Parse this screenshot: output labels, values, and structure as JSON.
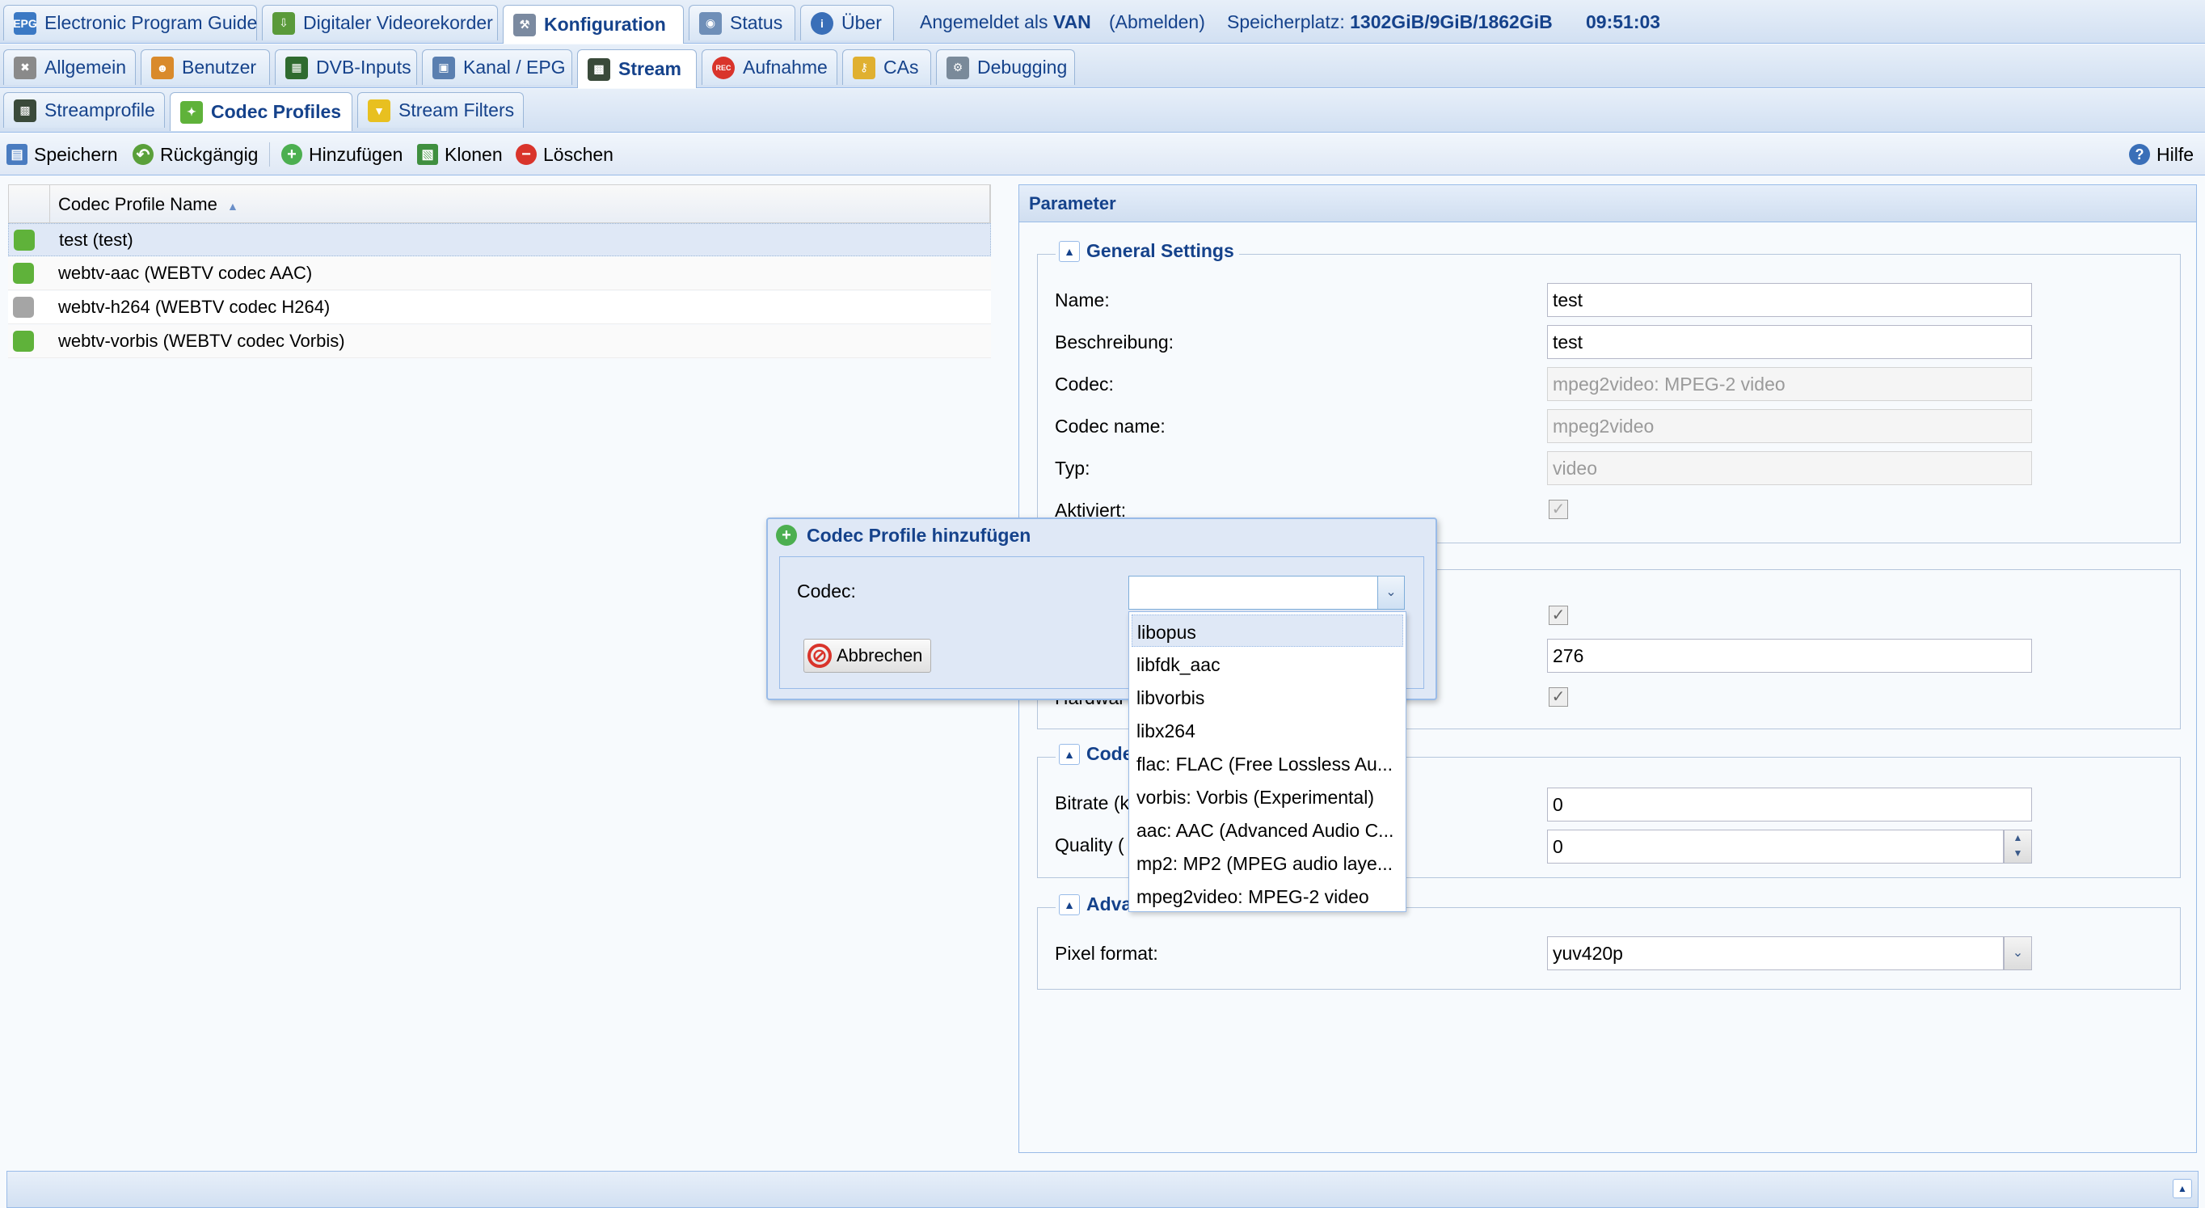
{
  "header": {
    "tabs": [
      {
        "label": "Electronic Program Guide"
      },
      {
        "label": "Digitaler Videorekorder"
      },
      {
        "label": "Konfiguration"
      },
      {
        "label": "Status"
      },
      {
        "label": "Über"
      }
    ],
    "logged_in_prefix": "Angemeldet als",
    "user": "VAN",
    "logout": "(Abmelden)",
    "storage_prefix": "Speicherplatz:",
    "storage": "1302GiB/9GiB/1862GiB",
    "time": "09:51:03"
  },
  "config_tabs": [
    {
      "label": "Allgemein"
    },
    {
      "label": "Benutzer"
    },
    {
      "label": "DVB-Inputs"
    },
    {
      "label": "Kanal / EPG"
    },
    {
      "label": "Stream"
    },
    {
      "label": "Aufnahme"
    },
    {
      "label": "CAs"
    },
    {
      "label": "Debugging"
    }
  ],
  "stream_tabs": [
    {
      "label": "Streamprofile"
    },
    {
      "label": "Codec Profiles"
    },
    {
      "label": "Stream Filters"
    }
  ],
  "toolbar": {
    "save": "Speichern",
    "undo": "Rückgängig",
    "add": "Hinzufügen",
    "clone": "Klonen",
    "delete": "Löschen",
    "help": "Hilfe"
  },
  "grid": {
    "column": "Codec Profile Name",
    "rows": [
      {
        "name": "test (test)"
      },
      {
        "name": "webtv-aac (WEBTV codec AAC)"
      },
      {
        "name": "webtv-h264 (WEBTV codec H264)"
      },
      {
        "name": "webtv-vorbis (WEBTV codec Vorbis)"
      }
    ]
  },
  "panel": {
    "title": "Parameter",
    "general": {
      "legend": "General Settings",
      "name_label": "Name:",
      "name_value": "test",
      "desc_label": "Beschreibung:",
      "desc_value": "test",
      "codec_label": "Codec:",
      "codec_value": "mpeg2video: MPEG-2 video",
      "codecname_label": "Codec name:",
      "codecname_value": "mpeg2video",
      "type_label": "Typ:",
      "type_value": "video",
      "enabled_label": "Aktiviert:"
    },
    "second": {
      "number_value": "276",
      "partial_label": "Hardwar"
    },
    "codec_section": {
      "legend_partial": "Code",
      "bitrate_label": "Bitrate (k",
      "bitrate_value": "0",
      "quality_label": "Quality (",
      "quality_value": "0"
    },
    "advanced": {
      "legend_partial": "Adva",
      "pixel_label": "Pixel format:",
      "pixel_value": "yuv420p"
    }
  },
  "dialog": {
    "title": "Codec Profile hinzufügen",
    "codec_label": "Codec:",
    "codec_value": "",
    "cancel": "Abbrechen",
    "options": [
      {
        "label": "libopus"
      },
      {
        "label": "libfdk_aac"
      },
      {
        "label": "libvorbis"
      },
      {
        "label": "libx264"
      },
      {
        "label": "flac: FLAC (Free Lossless Au..."
      },
      {
        "label": "vorbis: Vorbis (Experimental)"
      },
      {
        "label": "aac: AAC (Advanced Audio C..."
      },
      {
        "label": "mp2: MP2 (MPEG audio laye..."
      },
      {
        "label": "mpeg2video: MPEG-2 video"
      }
    ]
  },
  "colors": {
    "accent": "#15428b",
    "header_bg": "#dae7f6",
    "selected_row": "#dfe8f6",
    "delete_red": "#d9342b",
    "add_green": "#4caf50"
  }
}
